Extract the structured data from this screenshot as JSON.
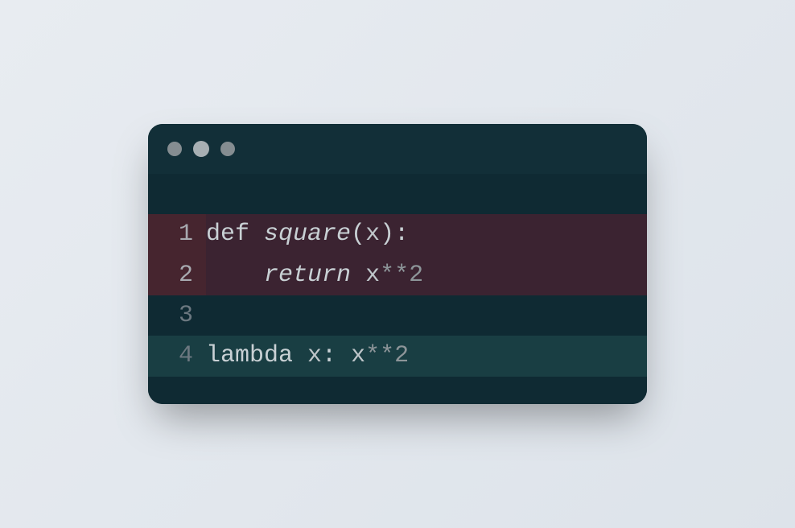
{
  "window": {
    "traffic_lights": [
      "close",
      "minimize",
      "maximize"
    ]
  },
  "code": {
    "lines": [
      {
        "number": "1",
        "diff": "removed",
        "tokens": [
          {
            "t": "def ",
            "cls": "tok-keyword"
          },
          {
            "t": "square",
            "cls": "tok-funcname"
          },
          {
            "t": "(",
            "cls": "tok-punct"
          },
          {
            "t": "x",
            "cls": "tok-var"
          },
          {
            "t": ")",
            "cls": "tok-punct"
          },
          {
            "t": ":",
            "cls": "tok-punct"
          }
        ]
      },
      {
        "number": "2",
        "diff": "removed",
        "tokens": [
          {
            "t": "    ",
            "cls": ""
          },
          {
            "t": "return",
            "cls": "tok-return"
          },
          {
            "t": " ",
            "cls": ""
          },
          {
            "t": "x",
            "cls": "tok-var"
          },
          {
            "t": "**",
            "cls": "tok-op"
          },
          {
            "t": "2",
            "cls": "tok-number"
          }
        ]
      },
      {
        "number": "3",
        "diff": "none",
        "tokens": []
      },
      {
        "number": "4",
        "diff": "added",
        "tokens": [
          {
            "t": "lambda ",
            "cls": "tok-keyword"
          },
          {
            "t": "x",
            "cls": "tok-var"
          },
          {
            "t": ": ",
            "cls": "tok-punct"
          },
          {
            "t": "x",
            "cls": "tok-var"
          },
          {
            "t": "**",
            "cls": "tok-op"
          },
          {
            "t": "2",
            "cls": "tok-number"
          }
        ]
      }
    ]
  }
}
